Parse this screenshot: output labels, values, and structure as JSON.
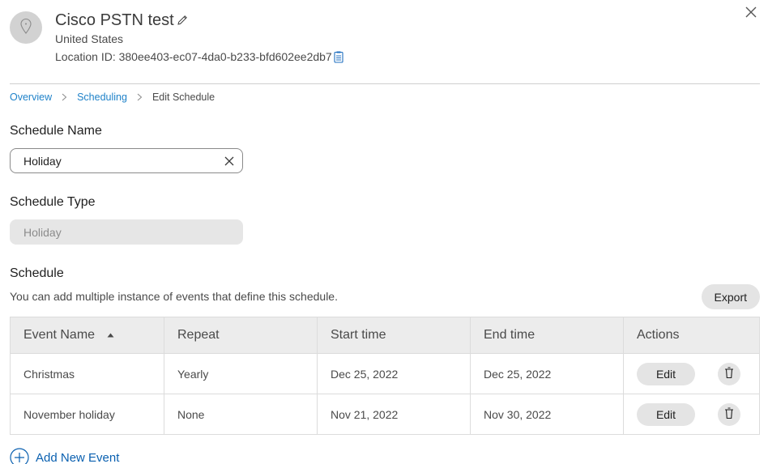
{
  "header": {
    "title": "Cisco PSTN test",
    "country": "United States",
    "location_id_label": "Location ID: 380ee403-ec07-4da0-b233-bfd602ee2db7",
    "avatar_icon": "map-pin-icon",
    "edit_icon": "pencil-icon",
    "copy_icon": "clipboard-icon",
    "close_icon": "close-icon"
  },
  "breadcrumb": {
    "items": [
      {
        "label": "Overview",
        "link": true
      },
      {
        "label": "Scheduling",
        "link": true
      },
      {
        "label": "Edit Schedule",
        "link": false
      }
    ]
  },
  "form": {
    "schedule_name_label": "Schedule Name",
    "schedule_name_value": "Holiday",
    "schedule_type_label": "Schedule Type",
    "schedule_type_value": "Holiday"
  },
  "schedule": {
    "title": "Schedule",
    "description": "You can add multiple instance of events that define this schedule.",
    "export_label": "Export",
    "columns": [
      "Event Name",
      "Repeat",
      "Start time",
      "End time",
      "Actions"
    ],
    "sort_column": "Event Name",
    "sort_direction": "ascending",
    "rows": [
      {
        "event_name": "Christmas",
        "repeat": "Yearly",
        "start": "Dec 25, 2022",
        "end": "Dec 25, 2022",
        "edit_label": "Edit"
      },
      {
        "event_name": "November holiday",
        "repeat": "None",
        "start": "Nov 21, 2022",
        "end": "Nov 30, 2022",
        "edit_label": "Edit"
      }
    ],
    "add_event_label": "Add New Event"
  },
  "colors": {
    "link": "#1f82c9",
    "add_link": "#0a60b0",
    "header_bg": "#ececec",
    "button_bg": "#e4e4e4"
  }
}
